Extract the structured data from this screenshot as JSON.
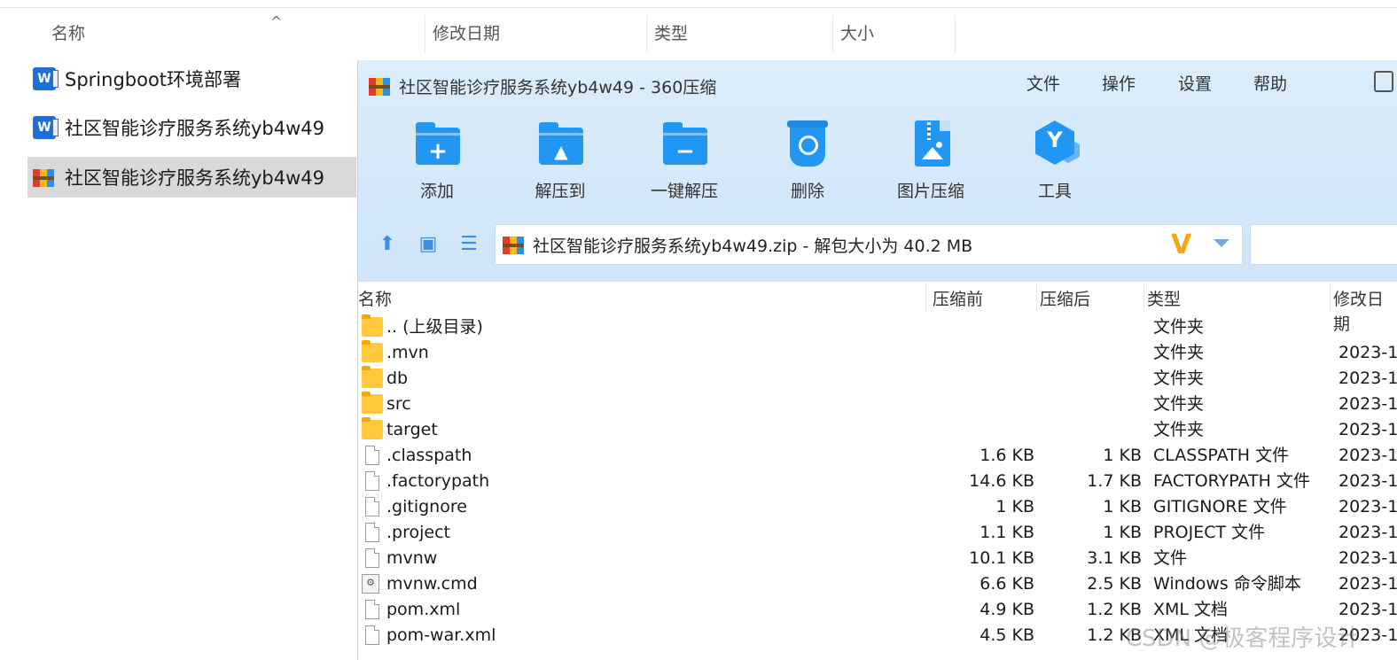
{
  "explorer": {
    "columns": [
      "名称",
      "修改日期",
      "类型",
      "大小"
    ],
    "sort_indicator": "^",
    "items": [
      {
        "label": "Springboot环境部署",
        "icon": "word-doc-icon",
        "selected": false
      },
      {
        "label": "社区智能诊疗服务系统yb4w49",
        "icon": "word-doc-icon",
        "selected": false
      },
      {
        "label": "社区智能诊疗服务系统yb4w49",
        "icon": "zip-archive-icon",
        "selected": true
      }
    ]
  },
  "window": {
    "title": "社区智能诊疗服务系统yb4w49 - 360压缩",
    "menu": [
      "文件",
      "操作",
      "设置",
      "帮助"
    ],
    "toolbar": [
      {
        "label": "添加",
        "icon": "add-folder-icon"
      },
      {
        "label": "解压到",
        "icon": "extract-to-icon"
      },
      {
        "label": "一键解压",
        "icon": "one-click-extract-icon"
      },
      {
        "label": "删除",
        "icon": "delete-bin-icon"
      },
      {
        "label": "图片压缩",
        "icon": "image-compress-icon"
      },
      {
        "label": "工具",
        "icon": "tools-icon"
      }
    ],
    "address": "社区智能诊疗服务系统yb4w49.zip - 解包大小为 40.2 MB",
    "address_badge": "V",
    "list": {
      "headers": {
        "name": "名称",
        "before": "压缩前",
        "after": "压缩后",
        "type": "类型",
        "date": "修改日期"
      },
      "rows": [
        {
          "name": ".. (上级目录)",
          "before": "",
          "after": "",
          "type": "文件夹",
          "date": "",
          "icon": "folder"
        },
        {
          "name": ".mvn",
          "before": "",
          "after": "",
          "type": "文件夹",
          "date": "2023-1",
          "icon": "folder"
        },
        {
          "name": "db",
          "before": "",
          "after": "",
          "type": "文件夹",
          "date": "2023-1",
          "icon": "folder"
        },
        {
          "name": "src",
          "before": "",
          "after": "",
          "type": "文件夹",
          "date": "2023-1",
          "icon": "folder"
        },
        {
          "name": "target",
          "before": "",
          "after": "",
          "type": "文件夹",
          "date": "2023-1",
          "icon": "folder"
        },
        {
          "name": ".classpath",
          "before": "1.6 KB",
          "after": "1 KB",
          "type": "CLASSPATH 文件",
          "date": "2023-1",
          "icon": "file"
        },
        {
          "name": ".factorypath",
          "before": "14.6 KB",
          "after": "1.7 KB",
          "type": "FACTORYPATH 文件",
          "date": "2023-1",
          "icon": "file"
        },
        {
          "name": ".gitignore",
          "before": "1 KB",
          "after": "1 KB",
          "type": "GITIGNORE 文件",
          "date": "2023-1",
          "icon": "file"
        },
        {
          "name": ".project",
          "before": "1.1 KB",
          "after": "1 KB",
          "type": "PROJECT 文件",
          "date": "2023-1",
          "icon": "file"
        },
        {
          "name": "mvnw",
          "before": "10.1 KB",
          "after": "3.1 KB",
          "type": "文件",
          "date": "2023-1",
          "icon": "file"
        },
        {
          "name": "mvnw.cmd",
          "before": "6.6 KB",
          "after": "2.5 KB",
          "type": "Windows 命令脚本",
          "date": "2023-1",
          "icon": "cmd"
        },
        {
          "name": "pom.xml",
          "before": "4.9 KB",
          "after": "1.2 KB",
          "type": "XML 文档",
          "date": "2023-1",
          "icon": "file"
        },
        {
          "name": "pom-war.xml",
          "before": "4.5 KB",
          "after": "1.2 KB",
          "type": "XML 文档",
          "date": "2023-1",
          "icon": "file"
        }
      ]
    }
  },
  "watermark": "CSDN @极客程序设计"
}
